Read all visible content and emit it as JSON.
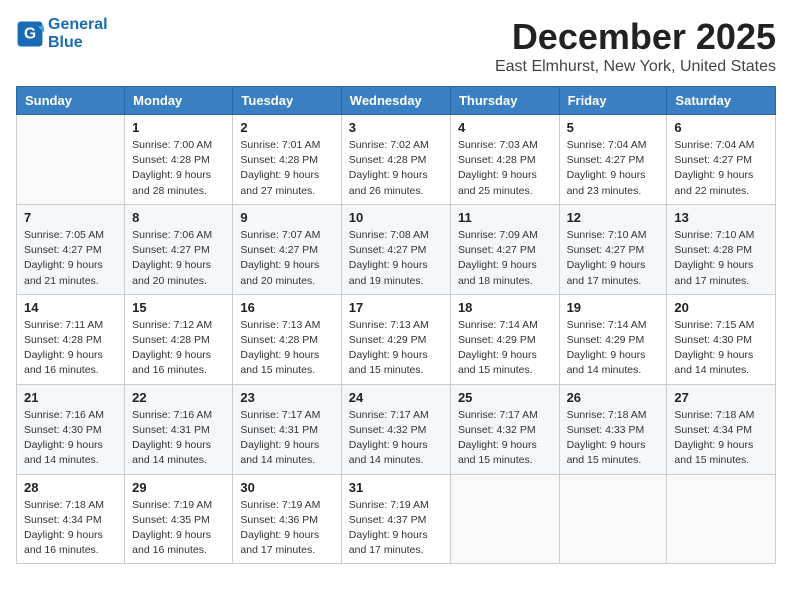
{
  "header": {
    "logo_line1": "General",
    "logo_line2": "Blue",
    "title": "December 2025",
    "subtitle": "East Elmhurst, New York, United States"
  },
  "columns": [
    "Sunday",
    "Monday",
    "Tuesday",
    "Wednesday",
    "Thursday",
    "Friday",
    "Saturday"
  ],
  "weeks": [
    [
      {
        "day": "",
        "info": ""
      },
      {
        "day": "1",
        "info": "Sunrise: 7:00 AM\nSunset: 4:28 PM\nDaylight: 9 hours\nand 28 minutes."
      },
      {
        "day": "2",
        "info": "Sunrise: 7:01 AM\nSunset: 4:28 PM\nDaylight: 9 hours\nand 27 minutes."
      },
      {
        "day": "3",
        "info": "Sunrise: 7:02 AM\nSunset: 4:28 PM\nDaylight: 9 hours\nand 26 minutes."
      },
      {
        "day": "4",
        "info": "Sunrise: 7:03 AM\nSunset: 4:28 PM\nDaylight: 9 hours\nand 25 minutes."
      },
      {
        "day": "5",
        "info": "Sunrise: 7:04 AM\nSunset: 4:27 PM\nDaylight: 9 hours\nand 23 minutes."
      },
      {
        "day": "6",
        "info": "Sunrise: 7:04 AM\nSunset: 4:27 PM\nDaylight: 9 hours\nand 22 minutes."
      }
    ],
    [
      {
        "day": "7",
        "info": "Sunrise: 7:05 AM\nSunset: 4:27 PM\nDaylight: 9 hours\nand 21 minutes."
      },
      {
        "day": "8",
        "info": "Sunrise: 7:06 AM\nSunset: 4:27 PM\nDaylight: 9 hours\nand 20 minutes."
      },
      {
        "day": "9",
        "info": "Sunrise: 7:07 AM\nSunset: 4:27 PM\nDaylight: 9 hours\nand 20 minutes."
      },
      {
        "day": "10",
        "info": "Sunrise: 7:08 AM\nSunset: 4:27 PM\nDaylight: 9 hours\nand 19 minutes."
      },
      {
        "day": "11",
        "info": "Sunrise: 7:09 AM\nSunset: 4:27 PM\nDaylight: 9 hours\nand 18 minutes."
      },
      {
        "day": "12",
        "info": "Sunrise: 7:10 AM\nSunset: 4:27 PM\nDaylight: 9 hours\nand 17 minutes."
      },
      {
        "day": "13",
        "info": "Sunrise: 7:10 AM\nSunset: 4:28 PM\nDaylight: 9 hours\nand 17 minutes."
      }
    ],
    [
      {
        "day": "14",
        "info": "Sunrise: 7:11 AM\nSunset: 4:28 PM\nDaylight: 9 hours\nand 16 minutes."
      },
      {
        "day": "15",
        "info": "Sunrise: 7:12 AM\nSunset: 4:28 PM\nDaylight: 9 hours\nand 16 minutes."
      },
      {
        "day": "16",
        "info": "Sunrise: 7:13 AM\nSunset: 4:28 PM\nDaylight: 9 hours\nand 15 minutes."
      },
      {
        "day": "17",
        "info": "Sunrise: 7:13 AM\nSunset: 4:29 PM\nDaylight: 9 hours\nand 15 minutes."
      },
      {
        "day": "18",
        "info": "Sunrise: 7:14 AM\nSunset: 4:29 PM\nDaylight: 9 hours\nand 15 minutes."
      },
      {
        "day": "19",
        "info": "Sunrise: 7:14 AM\nSunset: 4:29 PM\nDaylight: 9 hours\nand 14 minutes."
      },
      {
        "day": "20",
        "info": "Sunrise: 7:15 AM\nSunset: 4:30 PM\nDaylight: 9 hours\nand 14 minutes."
      }
    ],
    [
      {
        "day": "21",
        "info": "Sunrise: 7:16 AM\nSunset: 4:30 PM\nDaylight: 9 hours\nand 14 minutes."
      },
      {
        "day": "22",
        "info": "Sunrise: 7:16 AM\nSunset: 4:31 PM\nDaylight: 9 hours\nand 14 minutes."
      },
      {
        "day": "23",
        "info": "Sunrise: 7:17 AM\nSunset: 4:31 PM\nDaylight: 9 hours\nand 14 minutes."
      },
      {
        "day": "24",
        "info": "Sunrise: 7:17 AM\nSunset: 4:32 PM\nDaylight: 9 hours\nand 14 minutes."
      },
      {
        "day": "25",
        "info": "Sunrise: 7:17 AM\nSunset: 4:32 PM\nDaylight: 9 hours\nand 15 minutes."
      },
      {
        "day": "26",
        "info": "Sunrise: 7:18 AM\nSunset: 4:33 PM\nDaylight: 9 hours\nand 15 minutes."
      },
      {
        "day": "27",
        "info": "Sunrise: 7:18 AM\nSunset: 4:34 PM\nDaylight: 9 hours\nand 15 minutes."
      }
    ],
    [
      {
        "day": "28",
        "info": "Sunrise: 7:18 AM\nSunset: 4:34 PM\nDaylight: 9 hours\nand 16 minutes."
      },
      {
        "day": "29",
        "info": "Sunrise: 7:19 AM\nSunset: 4:35 PM\nDaylight: 9 hours\nand 16 minutes."
      },
      {
        "day": "30",
        "info": "Sunrise: 7:19 AM\nSunset: 4:36 PM\nDaylight: 9 hours\nand 17 minutes."
      },
      {
        "day": "31",
        "info": "Sunrise: 7:19 AM\nSunset: 4:37 PM\nDaylight: 9 hours\nand 17 minutes."
      },
      {
        "day": "",
        "info": ""
      },
      {
        "day": "",
        "info": ""
      },
      {
        "day": "",
        "info": ""
      }
    ]
  ]
}
